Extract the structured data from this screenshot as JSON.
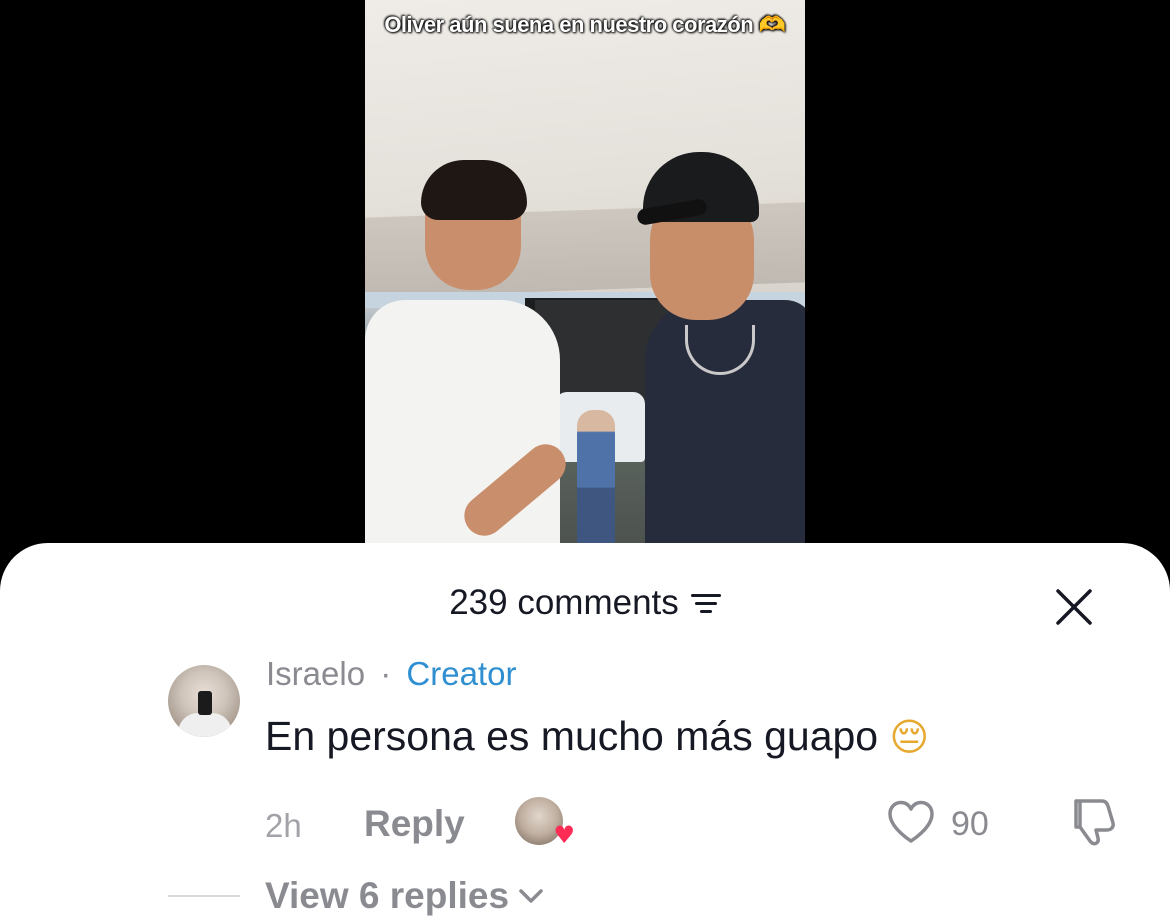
{
  "video": {
    "caption": "Oliver aún suena en nuestro corazón",
    "caption_emoji": "🫶"
  },
  "comments_panel": {
    "count_label": "239 comments",
    "filter_icon": "filter-icon",
    "close_icon": "close-icon"
  },
  "comment": {
    "username": "Israelo",
    "separator": "·",
    "badge": "Creator",
    "text": "En persona es mucho más guapo",
    "text_emoji": "😔",
    "time": "2h",
    "reply_label": "Reply",
    "like_count": "90",
    "view_replies_label": "View 6 replies"
  },
  "colors": {
    "accent_link": "#2f8fd0",
    "heart_red": "#fe2c55",
    "text_primary": "#161823",
    "text_secondary": "#8a8b91"
  }
}
